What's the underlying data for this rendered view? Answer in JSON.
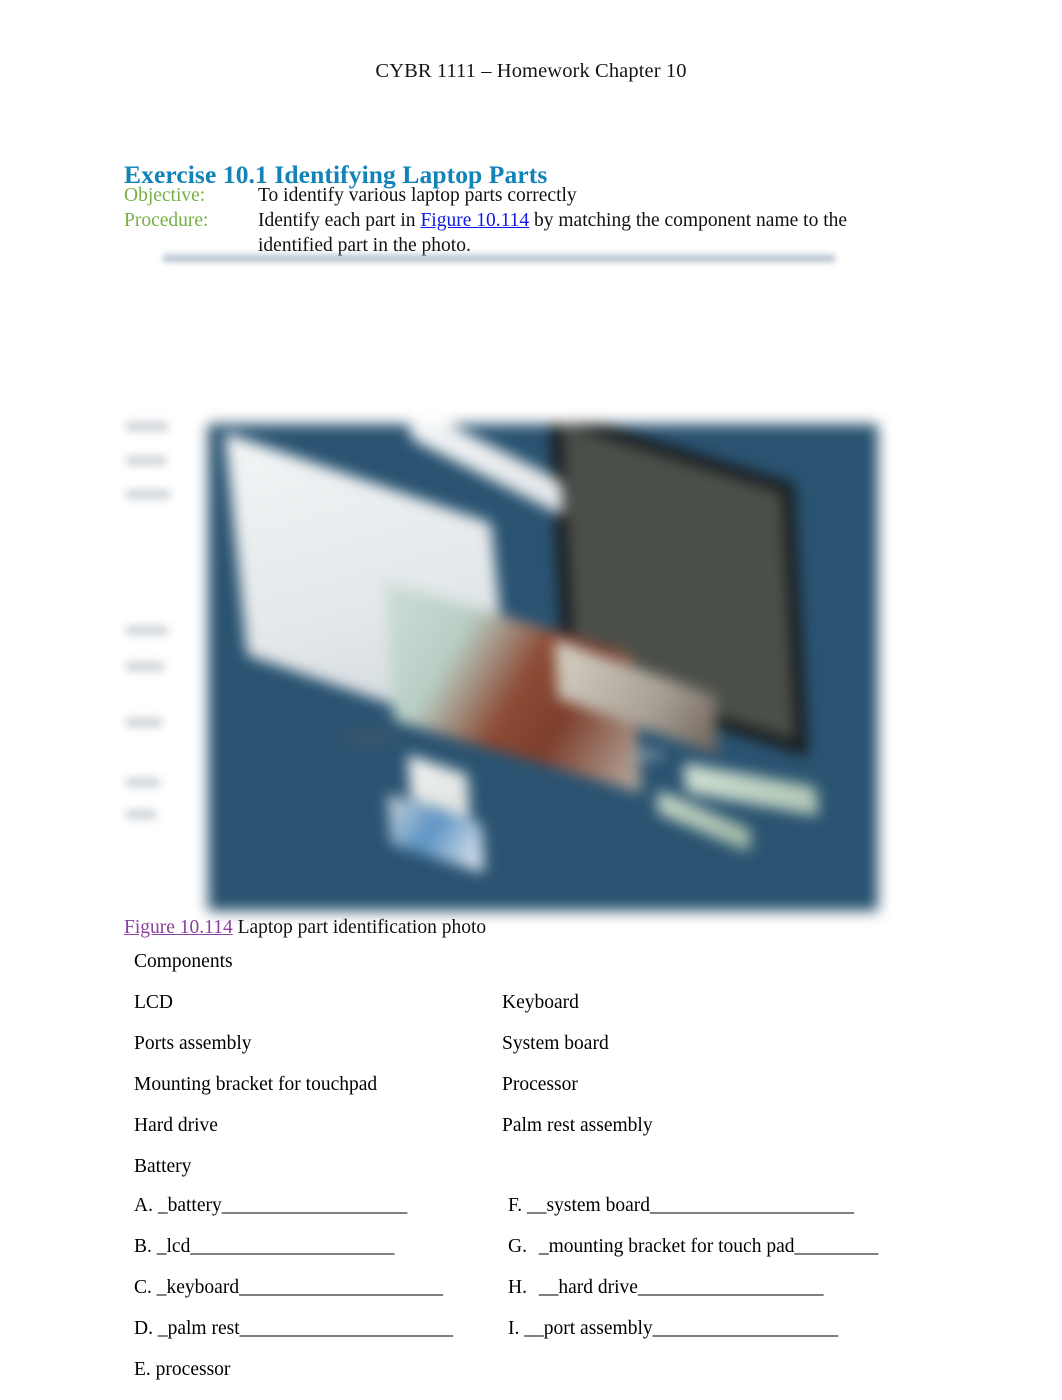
{
  "document": {
    "header": "CYBR 1111 – Homework Chapter 10"
  },
  "exercise": {
    "heading": "Exercise 10.1 Identifying Laptop Parts",
    "objective_label": "Objective:",
    "objective_text": "To identify various laptop parts correctly",
    "procedure_label": "Procedure:",
    "procedure_text_before": "Identify each part in ",
    "procedure_link": "Figure 10.114",
    "procedure_text_after": " by matching the component name to the identified part in the photo."
  },
  "figure": {
    "caption_link": "Figure 10.114",
    "caption_text": " Laptop part identification photo",
    "alt": "blurred photo of a disassembled laptop laid out on a dark blue surface"
  },
  "components": {
    "title": "Components",
    "rows": [
      {
        "left": "LCD",
        "right": "Keyboard"
      },
      {
        "left": "Ports assembly",
        "right": "System board"
      },
      {
        "left": "Mounting bracket for touchpad",
        "right": "Processor"
      },
      {
        "left": "Hard drive",
        "right": "Palm rest assembly"
      },
      {
        "left": "Battery",
        "right": ""
      }
    ]
  },
  "answers": {
    "rows": [
      {
        "left_letter": "A.",
        "left_answer": "_battery",
        "left_fill": "____________________",
        "right_letter": "F.",
        "right_answer": "__system board",
        "right_fill": "______________________"
      },
      {
        "left_letter": "B.",
        "left_answer": "_lcd",
        "left_fill": "______________________",
        "right_letter": "G.",
        "right_answer": "_mounting bracket for touch pad",
        "right_fill": "_________"
      },
      {
        "left_letter": "C.",
        "left_answer": "_keyboard",
        "left_fill": "______________________",
        "right_letter": "H.",
        "right_answer": "__hard drive",
        "right_fill": "____________________"
      },
      {
        "left_letter": "D.",
        "left_answer": "_palm rest",
        "left_fill": "_______________________",
        "right_letter": "I.",
        "right_answer": "__port assembly",
        "right_fill": "____________________"
      },
      {
        "left_letter": "E.",
        "left_answer": "  processor",
        "left_fill": "",
        "right_letter": "",
        "right_answer": "",
        "right_fill": ""
      }
    ]
  },
  "colors": {
    "heading_teal": "#1283b8",
    "label_green": "#76b043",
    "link_blue": "#1018e8",
    "link_purple": "#8b3f9e",
    "photo_background": "#2a5371",
    "body_text": "#111111"
  }
}
